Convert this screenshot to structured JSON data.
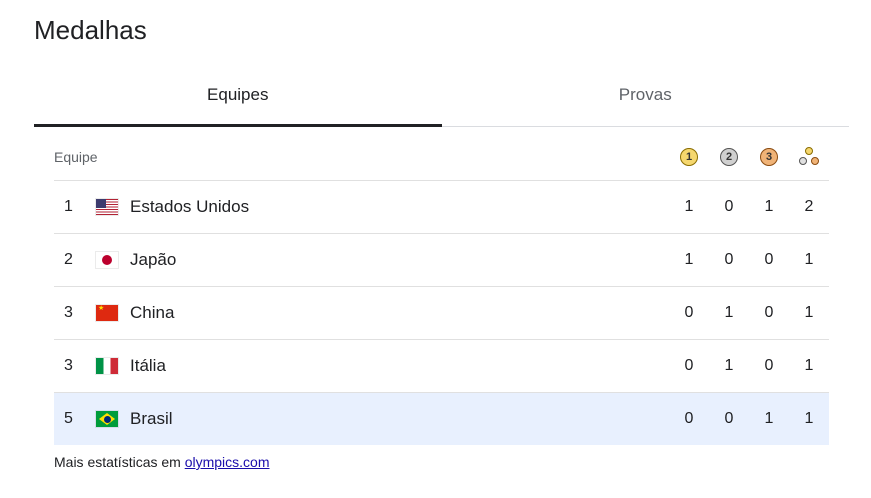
{
  "title": "Medalhas",
  "tabs": [
    {
      "label": "Equipes",
      "active": true
    },
    {
      "label": "Provas",
      "active": false
    }
  ],
  "table": {
    "team_header": "Equipe",
    "medal_headers": {
      "gold": "1",
      "silver": "2",
      "bronze": "3",
      "total_icon": "medals-total-icon"
    },
    "rows": [
      {
        "rank": "1",
        "country": "Estados Unidos",
        "flag": "flag-usa-icon",
        "gold": "1",
        "silver": "0",
        "bronze": "1",
        "total": "2"
      },
      {
        "rank": "2",
        "country": "Japão",
        "flag": "flag-japan-icon",
        "gold": "1",
        "silver": "0",
        "bronze": "0",
        "total": "1"
      },
      {
        "rank": "3",
        "country": "China",
        "flag": "flag-china-icon",
        "gold": "0",
        "silver": "1",
        "bronze": "0",
        "total": "1"
      },
      {
        "rank": "3",
        "country": "Itália",
        "flag": "flag-italy-icon",
        "gold": "0",
        "silver": "1",
        "bronze": "0",
        "total": "1"
      },
      {
        "rank": "5",
        "country": "Brasil",
        "flag": "flag-brazil-icon",
        "gold": "0",
        "silver": "0",
        "bronze": "1",
        "total": "1",
        "highlighted": true
      }
    ]
  },
  "footer": {
    "text": "Mais estatísticas em ",
    "link_text": "olympics.com"
  },
  "colors": {
    "highlight_row": "#e8f0fe",
    "link": "#1a0dab",
    "gold": "#f5d76e",
    "silver": "#d0d0d0",
    "bronze": "#f0b377"
  }
}
